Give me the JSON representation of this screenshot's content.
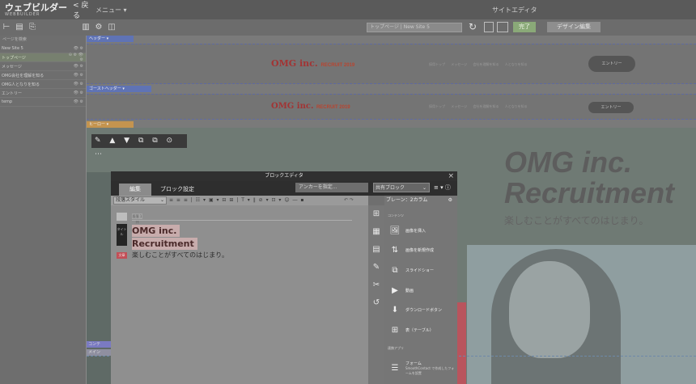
{
  "app": {
    "logo": "ウェブビルダー",
    "logo_sub": "WEBBUILDER",
    "back": "< 戻る",
    "menu": "メニュー ▾",
    "site_title": "サイトエディタ"
  },
  "toolbar": {
    "url": "トップページ | New Site 5",
    "save_label": "完了",
    "design_label": "デザイン編集"
  },
  "sidebar": {
    "search_placeholder": "ページを検索",
    "items": [
      {
        "label": "New Site 5",
        "ops": "👁 ⚙"
      },
      {
        "label": "トップページ",
        "ops": "⊖ ⚙ 👁 ⚙"
      },
      {
        "label": "メッセージ",
        "ops": "👁 ⚙"
      },
      {
        "label": "OMG会社を理解を知る",
        "ops": "👁 ⚙"
      },
      {
        "label": "OMG人となりを知る",
        "ops": "👁 ⚙"
      },
      {
        "label": "エントリー",
        "ops": "👁 ⚙"
      },
      {
        "label": "temp",
        "ops": "👁 ⚙"
      }
    ]
  },
  "canvas": {
    "header_label": "ヘッダー ▾",
    "gh_label": "ゴーストヘッダー ▾",
    "hero_label": "ヒーロー ▾",
    "logo_main": "OMG inc.",
    "logo_recruit": "RECRUIT 2019",
    "nav": "採用トップ メッセージ 会社を理解を知る 人となりを知る",
    "entry": "エントリー",
    "hero_title_1": "OMG inc.",
    "hero_title_2": "Recruitment",
    "hero_subtitle": "楽しむことがすべてのはじまり。",
    "block_toolbar": "✎ ▲ ▼ ⧉ ⧉ ⊙ ⋯",
    "cont1": "コンテ",
    "cont2": "メイン"
  },
  "editor": {
    "title": "ブロックエディタ",
    "tab_edit": "編集",
    "tab_props": "ブロック設定",
    "anchor_placeholder": "アンカーを指定...",
    "shared_select": "共有ブロック",
    "format_style": "段落スタイル",
    "format_icons": "≡ ≡ ≡ | ☷ ▾ ▣ ▾ ⊟ ⊞ | T ▾ ∥ ⊘ ▾ ⊡ ▾ ☺ ― ▪",
    "undo_redo": "↶ ↷",
    "block_tag": "段落 1列",
    "heading_tag": "タイトル",
    "para_tag": "文章",
    "heading_line1": "OMG inc.",
    "heading_line2": "Recruitment",
    "paragraph": "楽しむことがすべてのはじまり。",
    "layout_label": "ブレーン：2カラム",
    "contents_label": "コンテンツ",
    "parts": [
      {
        "icon": "🖼",
        "label": "画像を挿入"
      },
      {
        "icon": "⇅",
        "label": "画像を新規作成"
      },
      {
        "icon": "⧉",
        "label": "スライドショー"
      },
      {
        "icon": "▶",
        "label": "動画"
      },
      {
        "icon": "⬇",
        "label": "ダウンロードボタン"
      },
      {
        "icon": "⊞",
        "label": "表（テーブル）"
      }
    ],
    "apps_label": "連携アプリ",
    "form_label": "フォーム",
    "form_sub": "SmoothContact で作成したフォームを設置"
  }
}
